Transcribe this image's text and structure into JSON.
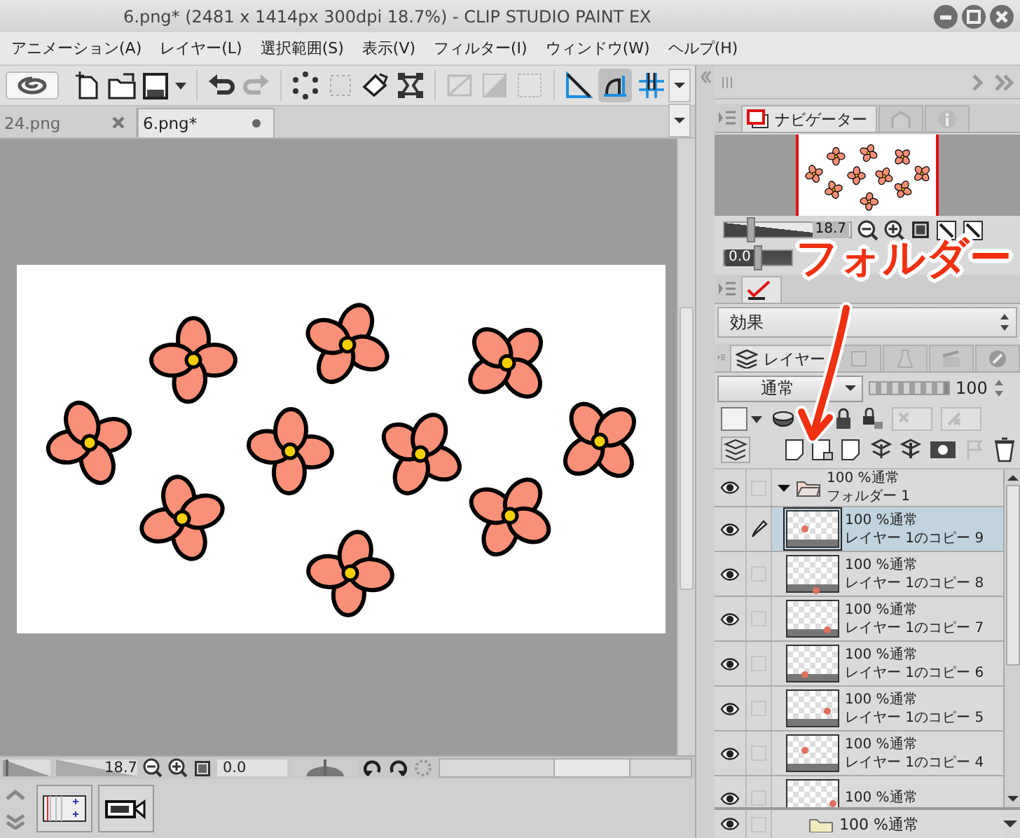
{
  "window": {
    "title": "6.png* (2481 x 1414px 300dpi 18.7%)  - CLIP STUDIO PAINT EX"
  },
  "menu": [
    "アニメーション(A)",
    "レイヤー(L)",
    "選択範囲(S)",
    "表示(V)",
    "フィルター(I)",
    "ウィンドウ(W)",
    "ヘルプ(H)"
  ],
  "document_tabs": [
    {
      "label": "24.png",
      "selected": false,
      "modified": false
    },
    {
      "label": "6.png*",
      "selected": true,
      "modified": true
    }
  ],
  "status_bar": {
    "zoom": "18.7",
    "zoom_slider": {
      "level": 0.1
    },
    "rotation": "0.0",
    "rotation_slider": {
      "level": 0.5
    }
  },
  "navigator": {
    "tab_label": "ナビゲーター",
    "zoom": "18.7",
    "zoom_slider": {
      "level": 0.22
    },
    "rotation": "0.0",
    "rotation_slider": {
      "level": 0.5
    }
  },
  "effect_dropdown": {
    "value": "効果"
  },
  "layer_palette": {
    "tab_label": "レイヤー",
    "blend_mode": "通常",
    "opacity": "100",
    "opacity_slider": {
      "level": 1
    }
  },
  "layers": [
    {
      "kind": "folder",
      "blend": "100 %通常",
      "name": "フォルダー 1",
      "visible": true,
      "expanded": true,
      "selected": false,
      "editing": false
    },
    {
      "kind": "layer",
      "blend": "100 %通常",
      "name": "レイヤー 1のコピー 9",
      "visible": true,
      "selected": true,
      "editing": true
    },
    {
      "kind": "layer",
      "blend": "100 %通常",
      "name": "レイヤー 1のコピー 8",
      "visible": true,
      "selected": false,
      "editing": false
    },
    {
      "kind": "layer",
      "blend": "100 %通常",
      "name": "レイヤー 1のコピー 7",
      "visible": true,
      "selected": false,
      "editing": false
    },
    {
      "kind": "layer",
      "blend": "100 %通常",
      "name": "レイヤー 1のコピー 6",
      "visible": true,
      "selected": false,
      "editing": false
    },
    {
      "kind": "layer",
      "blend": "100 %通常",
      "name": "レイヤー 1のコピー 5",
      "visible": true,
      "selected": false,
      "editing": false
    },
    {
      "kind": "layer",
      "blend": "100 %通常",
      "name": "レイヤー 1のコピー 4",
      "visible": true,
      "selected": false,
      "editing": false
    },
    {
      "kind": "layer",
      "blend": "100 %通常",
      "visible": true,
      "selected": false,
      "editing": false
    }
  ],
  "layers_below": [
    {
      "kind": "folder",
      "blend": "100 %通常",
      "visible": true,
      "expanded": false,
      "selected": false,
      "editing": false
    }
  ],
  "annotation": {
    "text": "フォルダー"
  }
}
